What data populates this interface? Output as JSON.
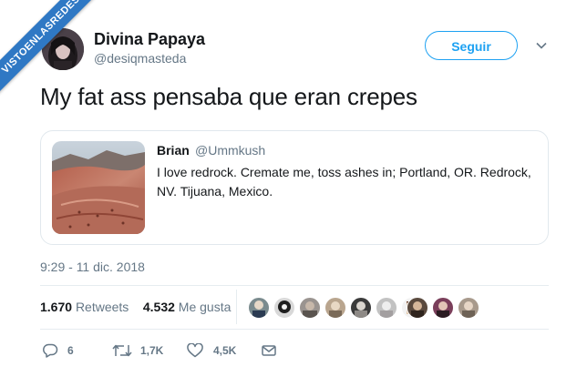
{
  "watermark": "VISTOENLASREDES",
  "author": {
    "name": "Divina Papaya",
    "handle": "@desiqmasteda"
  },
  "follow_label": "Seguir",
  "tweet_text": "My fat ass pensaba que eran crepes",
  "quoted": {
    "name": "Brian",
    "handle": "@Ummkush",
    "text": "I love redrock. Cremate me, toss ashes in; Portland, OR. Redrock, NV. Tijuana, Mexico."
  },
  "timestamp": "9:29 - 11 dic. 2018",
  "stats": {
    "retweets_count": "1.670",
    "retweets_label": "Retweets",
    "likes_count": "4.532",
    "likes_label": "Me gusta"
  },
  "actions": {
    "replies": "6",
    "retweets": "1,7K",
    "likes": "4,5K"
  },
  "colors": {
    "accent": "#1da1f2",
    "muted": "#657786",
    "ribbon": "#2f78c4"
  },
  "icons": [
    "chevron-down-icon",
    "reply-icon",
    "retweet-icon",
    "heart-icon",
    "message-icon"
  ]
}
